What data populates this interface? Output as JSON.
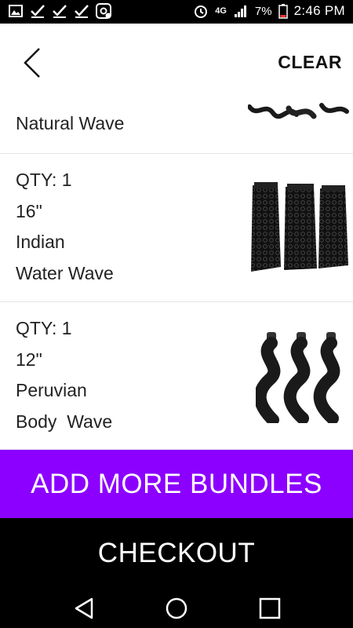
{
  "status_bar": {
    "icons_left": [
      "image-icon",
      "check-icon",
      "check-icon",
      "check-icon",
      "at-icon"
    ],
    "network": "4G",
    "battery": "7%",
    "time": "2:46 PM"
  },
  "header": {
    "back_icon": "chevron-left-icon",
    "clear_label": "CLEAR"
  },
  "items": [
    {
      "lines": [
        "Natural Wave"
      ]
    },
    {
      "lines": [
        "QTY: 1",
        "16\"",
        "Indian",
        "Water Wave"
      ]
    },
    {
      "lines": [
        "QTY: 1",
        "12\"",
        "Peruvian",
        "Body  Wave"
      ]
    }
  ],
  "buttons": {
    "add_more": "ADD MORE BUNDLES",
    "checkout": "CHECKOUT"
  },
  "nav": {
    "back": "triangle-back-icon",
    "home": "circle-home-icon",
    "recents": "square-recents-icon"
  },
  "colors": {
    "accent": "#8c00ff",
    "checkout_bg": "#000000"
  }
}
